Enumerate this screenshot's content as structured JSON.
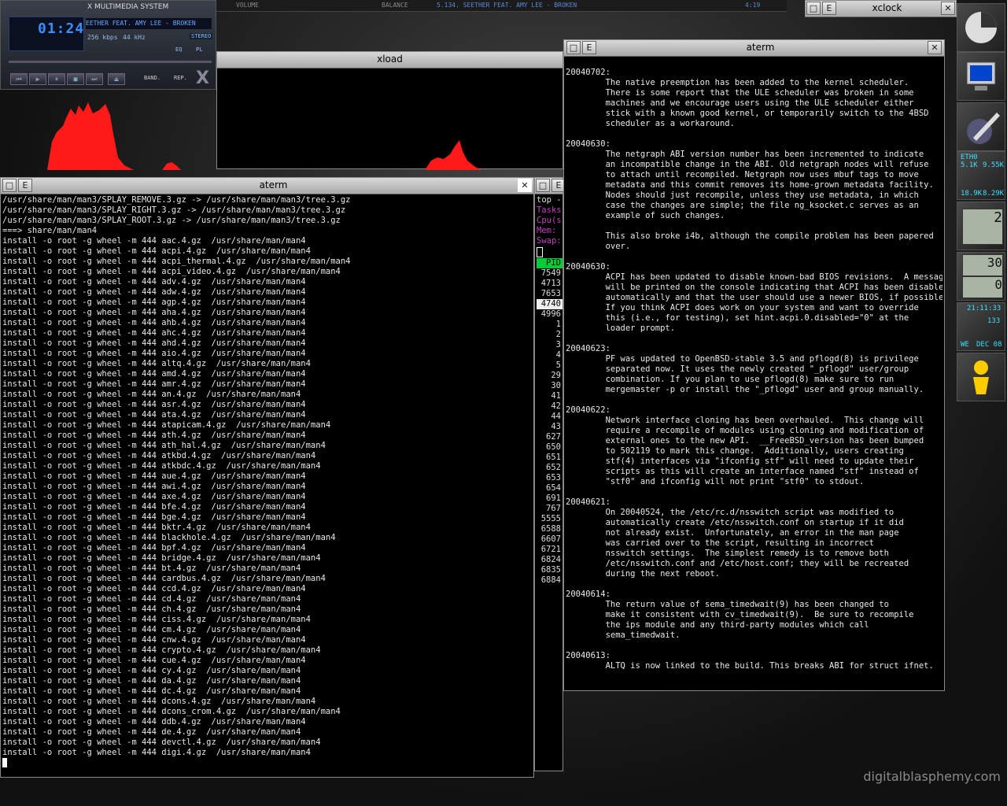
{
  "xmms": {
    "title": "X MULTIMEDIA SYSTEM",
    "time": "01:24",
    "song": "EETHER FEAT. AMY LEE - BROKEN",
    "bitrate": "256 kbps",
    "frequency": "44 kHz",
    "stereo": "STEREO",
    "eq": "EQ",
    "pl": "PL",
    "band": "BAND.",
    "rep": "REP.",
    "brand": "X"
  },
  "topbar": {
    "volume_label": "VOLUME",
    "balance_label": "BALANCE",
    "song": "5.134. SEETHER FEAT. AMY LEE - BROKEN",
    "time": "4:19"
  },
  "xload": {
    "title": "xload"
  },
  "xclock": {
    "title": "xclock"
  },
  "term_left": {
    "title": "aterm",
    "lines": [
      "/usr/share/man/man3/SPLAY_REMOVE.3.gz -> /usr/share/man/man3/tree.3.gz",
      "/usr/share/man/man3/SPLAY_RIGHT.3.gz -> /usr/share/man/man3/tree.3.gz",
      "/usr/share/man/man3/SPLAY_ROOT.3.gz -> /usr/share/man/man3/tree.3.gz",
      "===> share/man/man4",
      "install -o root -g wheel -m 444 aac.4.gz  /usr/share/man/man4",
      "install -o root -g wheel -m 444 acpi.4.gz  /usr/share/man/man4",
      "install -o root -g wheel -m 444 acpi_thermal.4.gz  /usr/share/man/man4",
      "install -o root -g wheel -m 444 acpi_video.4.gz  /usr/share/man/man4",
      "install -o root -g wheel -m 444 adv.4.gz  /usr/share/man/man4",
      "install -o root -g wheel -m 444 adw.4.gz  /usr/share/man/man4",
      "install -o root -g wheel -m 444 agp.4.gz  /usr/share/man/man4",
      "install -o root -g wheel -m 444 aha.4.gz  /usr/share/man/man4",
      "install -o root -g wheel -m 444 ahb.4.gz  /usr/share/man/man4",
      "install -o root -g wheel -m 444 ahc.4.gz  /usr/share/man/man4",
      "install -o root -g wheel -m 444 ahd.4.gz  /usr/share/man/man4",
      "install -o root -g wheel -m 444 aio.4.gz  /usr/share/man/man4",
      "install -o root -g wheel -m 444 altq.4.gz  /usr/share/man/man4",
      "install -o root -g wheel -m 444 amd.4.gz  /usr/share/man/man4",
      "install -o root -g wheel -m 444 amr.4.gz  /usr/share/man/man4",
      "install -o root -g wheel -m 444 an.4.gz  /usr/share/man/man4",
      "install -o root -g wheel -m 444 asr.4.gz  /usr/share/man/man4",
      "install -o root -g wheel -m 444 ata.4.gz  /usr/share/man/man4",
      "install -o root -g wheel -m 444 atapicam.4.gz  /usr/share/man/man4",
      "install -o root -g wheel -m 444 ath.4.gz  /usr/share/man/man4",
      "install -o root -g wheel -m 444 ath_hal.4.gz  /usr/share/man/man4",
      "install -o root -g wheel -m 444 atkbd.4.gz  /usr/share/man/man4",
      "install -o root -g wheel -m 444 atkbdc.4.gz  /usr/share/man/man4",
      "install -o root -g wheel -m 444 aue.4.gz  /usr/share/man/man4",
      "install -o root -g wheel -m 444 awi.4.gz  /usr/share/man/man4",
      "install -o root -g wheel -m 444 axe.4.gz  /usr/share/man/man4",
      "install -o root -g wheel -m 444 bfe.4.gz  /usr/share/man/man4",
      "install -o root -g wheel -m 444 bge.4.gz  /usr/share/man/man4",
      "install -o root -g wheel -m 444 bktr.4.gz  /usr/share/man/man4",
      "install -o root -g wheel -m 444 blackhole.4.gz  /usr/share/man/man4",
      "install -o root -g wheel -m 444 bpf.4.gz  /usr/share/man/man4",
      "install -o root -g wheel -m 444 bridge.4.gz  /usr/share/man/man4",
      "install -o root -g wheel -m 444 bt.4.gz  /usr/share/man/man4",
      "install -o root -g wheel -m 444 cardbus.4.gz  /usr/share/man/man4",
      "install -o root -g wheel -m 444 ccd.4.gz  /usr/share/man/man4",
      "install -o root -g wheel -m 444 cd.4.gz  /usr/share/man/man4",
      "install -o root -g wheel -m 444 ch.4.gz  /usr/share/man/man4",
      "install -o root -g wheel -m 444 ciss.4.gz  /usr/share/man/man4",
      "install -o root -g wheel -m 444 cm.4.gz  /usr/share/man/man4",
      "install -o root -g wheel -m 444 cnw.4.gz  /usr/share/man/man4",
      "install -o root -g wheel -m 444 crypto.4.gz  /usr/share/man/man4",
      "install -o root -g wheel -m 444 cue.4.gz  /usr/share/man/man4",
      "install -o root -g wheel -m 444 cy.4.gz  /usr/share/man/man4",
      "install -o root -g wheel -m 444 da.4.gz  /usr/share/man/man4",
      "install -o root -g wheel -m 444 dc.4.gz  /usr/share/man/man4",
      "install -o root -g wheel -m 444 dcons.4.gz  /usr/share/man/man4",
      "install -o root -g wheel -m 444 dcons_crom.4.gz  /usr/share/man/man4",
      "install -o root -g wheel -m 444 ddb.4.gz  /usr/share/man/man4",
      "install -o root -g wheel -m 444 de.4.gz  /usr/share/man/man4",
      "install -o root -g wheel -m 444 devctl.4.gz  /usr/share/man/man4",
      "install -o root -g wheel -m 444 digi.4.gz  /usr/share/man/man4"
    ]
  },
  "top_win": {
    "header": [
      "top -",
      "Tasks:",
      "Cpu(s)",
      "Mem:",
      "Swap:"
    ],
    "pid_label": "PID",
    "pids": [
      "7549",
      "4713",
      "7653",
      "4740",
      "4996",
      "1",
      "2",
      "3",
      "4",
      "5",
      "29",
      "30",
      "41",
      "42",
      "44",
      "43",
      "627",
      "650",
      "651",
      "652",
      "653",
      "654",
      "691",
      "767",
      "5555",
      "6588",
      "6607",
      "6721",
      "6824",
      "6835",
      "6884"
    ],
    "highlight_pid": "4740"
  },
  "term_right": {
    "title": "aterm",
    "lines": [
      "",
      "20040702:",
      "        The native preemption has been added to the kernel scheduler.",
      "        There is some report that the ULE scheduler was broken in some",
      "        machines and we encourage users using the ULE scheduler either",
      "        stick with a known good kernel, or temporarily switch to the 4BSD",
      "        scheduler as a workaround.",
      "",
      "20040630:",
      "        The netgraph ABI version number has been incremented to indicate",
      "        an incompatible change in the ABI. Old netgraph nodes will refuse",
      "        to attach until recompiled. Netgraph now uses mbuf tags to move",
      "        metadata and this commit removes its home-grown metadata facility.",
      "        Nodes should just recompile, unless they use metadata, in which",
      "        case the changes are simple; the file ng_ksocket.c serves as an",
      "        example of such changes.",
      "",
      "        This also broke i4b, although the compile problem has been papered",
      "        over.",
      "",
      "20040630:",
      "        ACPI has been updated to disable known-bad BIOS revisions.  A message",
      "        will be printed on the console indicating that ACPI has been disabled",
      "        automatically and that the user should use a newer BIOS, if possible.",
      "        If you think ACPI does work on your system and want to override",
      "        this (i.e., for testing), set hint.acpi.0.disabled=\"0\" at the",
      "        loader prompt.",
      "",
      "20040623:",
      "        PF was updated to OpenBSD-stable 3.5 and pflogd(8) is privilege",
      "        separated now. It uses the newly created \"_pflogd\" user/group",
      "        combination. If you plan to use pflogd(8) make sure to run",
      "        mergemaster -p or install the \"_pflogd\" user and group manually.",
      "",
      "20040622:",
      "        Network interface cloning has been overhauled.  This change will",
      "        require a recompile of modules using cloning and modification of",
      "        external ones to the new API.  __FreeBSD_version has been bumped",
      "        to 502119 to mark this change.  Additionally, users creating",
      "        stf(4) interfaces via \"ifconfig stf\" will need to update their",
      "        scripts as this will create an interface named \"stf\" instead of",
      "        \"stf0\" and ifconfig will not print \"stf0\" to stdout.",
      "",
      "20040621:",
      "        On 20040524, the /etc/rc.d/nsswitch script was modified to",
      "        automatically create /etc/nsswitch.conf on startup if it did",
      "        not already exist.  Unfortunately, an error in the man page",
      "        was carried over to the script, resulting in incorrect",
      "        nsswitch settings.  The simplest remedy is to remove both",
      "        /etc/nsswitch.conf and /etc/host.conf; they will be recreated",
      "        during the next reboot.",
      "",
      "20040614:",
      "        The return value of sema_timedwait(9) has been changed to",
      "        make it consistent with cv_timedwait(9).  Be sure to recompile",
      "        the ips module and any third-party modules which call",
      "        sema_timedwait.",
      "",
      "20040613:",
      "        ALTQ is now linked to the build. This breaks ABI for struct ifnet."
    ]
  },
  "dock": {
    "net_label": "ETH0",
    "net_rate_1": "5.1K",
    "net_rate_2": "9.55K",
    "net_rate_3": "18.9K",
    "net_rate_4": "8.29K",
    "cpu_value": "2",
    "mem_value": "30",
    "mem_value2": "0",
    "clock_time": "21:11:33",
    "clock_sub": "133",
    "day": "WE",
    "date": "DEC 08"
  },
  "wallpaper": {
    "watermark": "digitalblasphemy.com"
  },
  "colors": {
    "accent_red": "#ff1a1a",
    "term_bg": "#000000",
    "pid_highlight": "#00cc33"
  }
}
